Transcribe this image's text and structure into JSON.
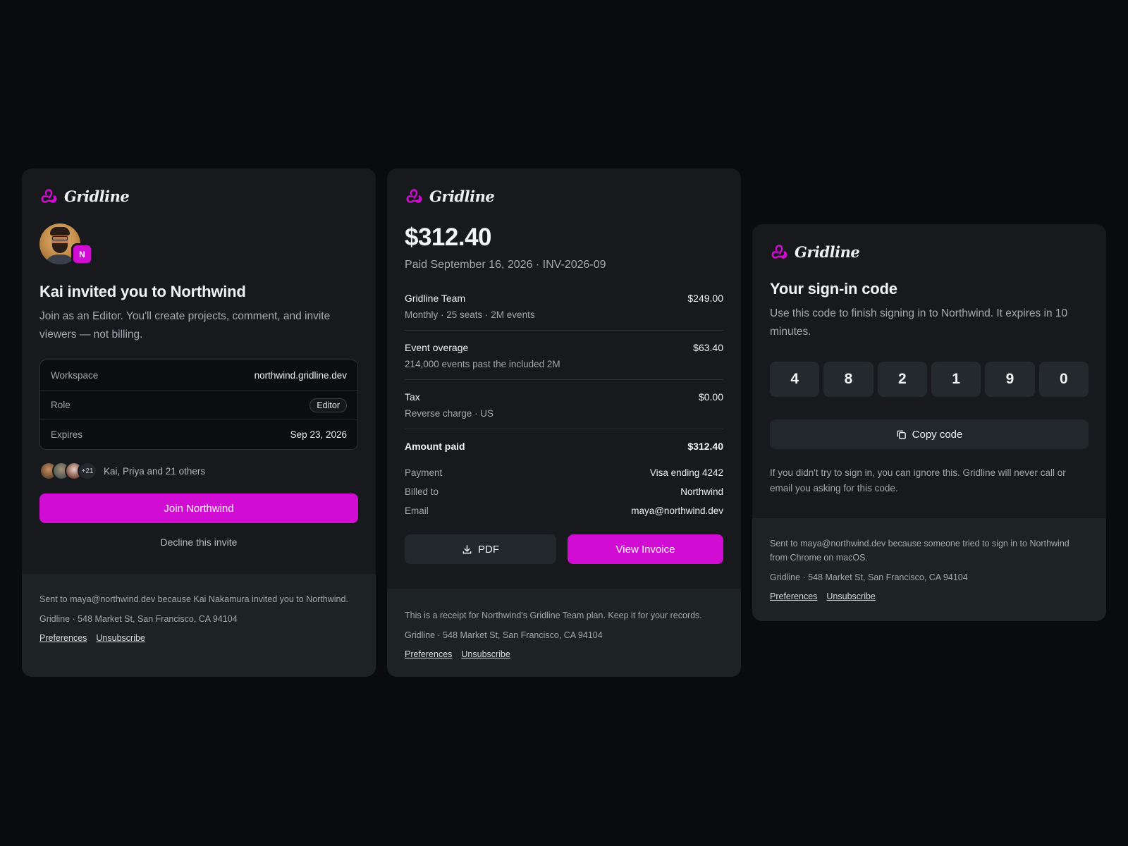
{
  "brand": {
    "name": "Gridline",
    "accent": "#d10cd3"
  },
  "invite": {
    "avatar_badge": "N",
    "title": "Kai invited you to Northwind",
    "lead": "Join as an Editor. You'll create projects, comment, and invite viewers — not billing.",
    "details": [
      {
        "label": "Workspace",
        "value": "northwind.gridline.dev"
      },
      {
        "label": "Role",
        "value": "Editor"
      },
      {
        "label": "Expires",
        "value": "Sep 23, 2026"
      }
    ],
    "members_more": "+21",
    "members_label": "Kai, Priya and 21 others",
    "join_label": "Join Northwind",
    "decline_label": "Decline this invite",
    "footer": {
      "reason": "Sent to maya@northwind.dev because Kai Nakamura invited you to Northwind.",
      "address": "Gridline · 548 Market St, San Francisco, CA 94104",
      "preferences": "Preferences",
      "unsubscribe": "Unsubscribe"
    }
  },
  "receipt": {
    "amount": "$312.40",
    "paid_line": "Paid September 16, 2026 · INV-2026-09",
    "items": [
      {
        "name": "Gridline Team",
        "amount": "$249.00",
        "sub": "Monthly · 25 seats · 2M events"
      },
      {
        "name": "Event overage",
        "amount": "$63.40",
        "sub": "214,000 events past the included 2M"
      },
      {
        "name": "Tax",
        "amount": "$0.00",
        "sub": "Reverse charge · US"
      }
    ],
    "total_label": "Amount paid",
    "total_value": "$312.40",
    "meta": [
      {
        "label": "Payment",
        "value": "Visa ending 4242"
      },
      {
        "label": "Billed to",
        "value": "Northwind"
      },
      {
        "label": "Email",
        "value": "maya@northwind.dev"
      }
    ],
    "pdf_label": "PDF",
    "view_label": "View Invoice",
    "footer": {
      "reason": "This is a receipt for Northwind's Gridline Team plan. Keep it for your records.",
      "address": "Gridline · 548 Market St, San Francisco, CA 94104",
      "preferences": "Preferences",
      "unsubscribe": "Unsubscribe"
    }
  },
  "code": {
    "title": "Your sign-in code",
    "lead": "Use this code to finish signing in to Northwind. It expires in 10 minutes.",
    "digits": [
      "4",
      "8",
      "2",
      "1",
      "9",
      "0"
    ],
    "copy_label": "Copy code",
    "notice": "If you didn't try to sign in, you can ignore this. Gridline will never call or email you asking for this code.",
    "footer": {
      "reason": "Sent to maya@northwind.dev because someone tried to sign in to Northwind from Chrome on macOS.",
      "address": "Gridline · 548 Market St, San Francisco, CA 94104",
      "preferences": "Preferences",
      "unsubscribe": "Unsubscribe"
    }
  }
}
